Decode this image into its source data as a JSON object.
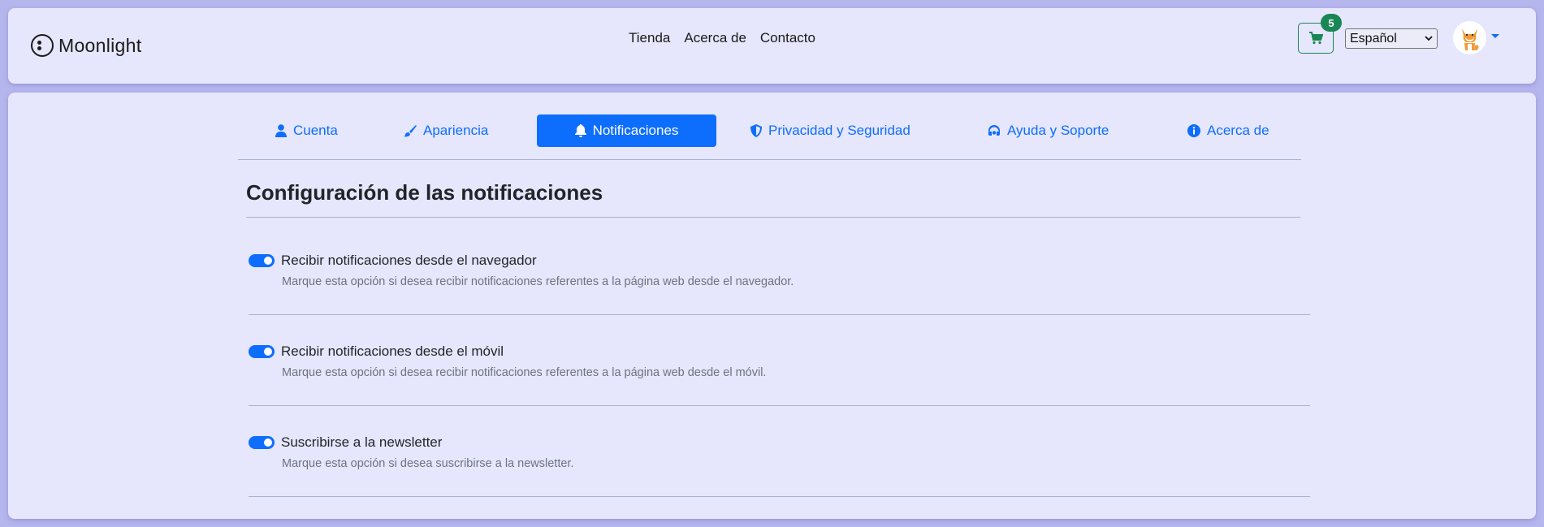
{
  "brand": {
    "name": "Moonlight"
  },
  "nav": {
    "links": [
      "Tienda",
      "Acerca de",
      "Contacto"
    ]
  },
  "cart": {
    "count": "5"
  },
  "language": {
    "selected": "Español"
  },
  "tabs": [
    {
      "label": "Cuenta",
      "icon": "user-icon"
    },
    {
      "label": "Apariencia",
      "icon": "paintbrush-icon"
    },
    {
      "label": "Notificaciones",
      "icon": "bell-icon",
      "active": true
    },
    {
      "label": "Privacidad y Seguridad",
      "icon": "shield-icon"
    },
    {
      "label": "Ayuda y Soporte",
      "icon": "headset-icon"
    },
    {
      "label": "Acerca de",
      "icon": "info-icon"
    }
  ],
  "section": {
    "title": "Configuración de las notificaciones"
  },
  "settings": [
    {
      "label": "Recibir notificaciones desde el navegador",
      "description": "Marque esta opción si desea recibir notificaciones referentes a la página web desde el navegador.",
      "enabled": true
    },
    {
      "label": "Recibir notificaciones desde el móvil",
      "description": "Marque esta opción si desea recibir notificaciones referentes a la página web desde el móvil.",
      "enabled": true
    },
    {
      "label": "Suscribirse a la newsletter",
      "description": "Marque esta opción si desea suscribirse a la newsletter.",
      "enabled": true
    }
  ],
  "colors": {
    "accent": "#0d6efd",
    "success": "#198754",
    "background": "#b6b6ee",
    "panel": "#e6e6fc"
  }
}
